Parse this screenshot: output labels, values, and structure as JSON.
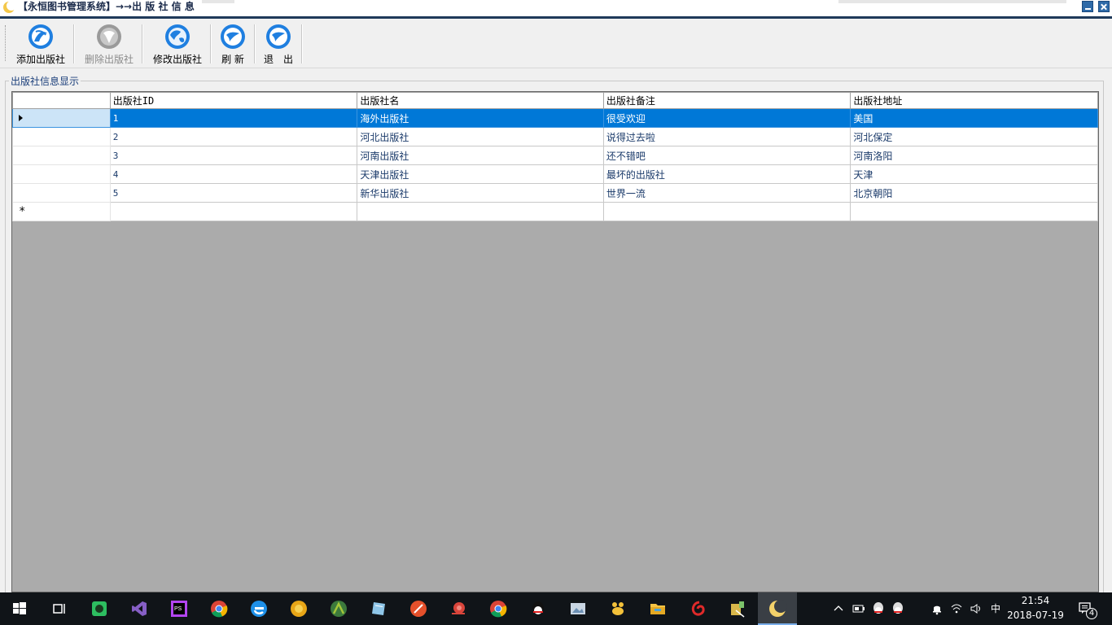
{
  "window": {
    "title": "【永恒图书管理系统】→→出 版 社 信 息"
  },
  "toolbar": {
    "buttons": [
      {
        "label": "添加出版社",
        "icon": "globe-add-icon",
        "enabled": true
      },
      {
        "label": "删除出版社",
        "icon": "globe-delete-icon",
        "enabled": false
      },
      {
        "label": "修改出版社",
        "icon": "globe-edit-icon",
        "enabled": true
      },
      {
        "label": "刷 新",
        "icon": "refresh-icon",
        "enabled": true
      },
      {
        "label": "退　出",
        "icon": "exit-icon",
        "enabled": true
      }
    ]
  },
  "group": {
    "title": "出版社信息显示"
  },
  "grid": {
    "columns": [
      "出版社ID",
      "出版社名",
      "出版社备注",
      "出版社地址"
    ],
    "rows": [
      {
        "id": "1",
        "name": "海外出版社",
        "note": "很受欢迎",
        "address": "美国",
        "selected": true
      },
      {
        "id": "2",
        "name": "河北出版社",
        "note": "说得过去啦",
        "address": "河北保定",
        "selected": false
      },
      {
        "id": "3",
        "name": "河南出版社",
        "note": "还不错吧",
        "address": "河南洛阳",
        "selected": false
      },
      {
        "id": "4",
        "name": "天津出版社",
        "note": "最坏的出版社",
        "address": "天津",
        "selected": false
      },
      {
        "id": "5",
        "name": "新华出版社",
        "note": "世界一流",
        "address": "北京朝阳",
        "selected": false
      }
    ],
    "new_row_marker": "*"
  },
  "taskbar": {
    "apps": [
      "start-icon",
      "task-view-icon",
      "evernote-icon",
      "visual-studio-icon",
      "phpstorm-icon",
      "chrome-icon",
      "edge-icon",
      "yellow-circle-icon",
      "android-studio-icon",
      "notepad-icon",
      "pencil-icon",
      "snail-icon",
      "chrome-icon",
      "qq-icon",
      "image-viewer-icon",
      "paw-icon",
      "file-explorer-icon",
      "netease-icon",
      "db-tools-icon",
      "moon-app-icon"
    ],
    "tray": {
      "ime": "中",
      "time": "21:54",
      "date": "2018-07-19",
      "notifications": "4"
    }
  }
}
